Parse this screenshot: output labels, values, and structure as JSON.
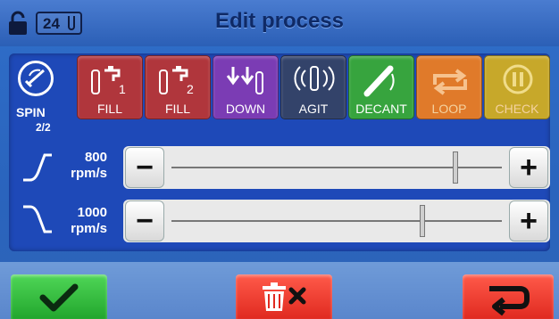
{
  "header": {
    "title": "Edit process",
    "counter": "24",
    "lock_icon": "lock-open-icon"
  },
  "spin": {
    "label": "SPIN",
    "count": "2/2",
    "icon": "spin-icon"
  },
  "steps": [
    {
      "label": "FILL",
      "sub": "1",
      "icon": "fill-tap-icon",
      "color": "#b0363c"
    },
    {
      "label": "FILL",
      "sub": "2",
      "icon": "fill-tap-icon",
      "color": "#b0363c"
    },
    {
      "label": "DOWN",
      "icon": "down-arrows-icon",
      "color": "#7b3cb4"
    },
    {
      "label": "AGIT",
      "icon": "agitate-icon",
      "color": "#33436a"
    },
    {
      "label": "DECANT",
      "icon": "decant-icon",
      "color": "#37a43e"
    },
    {
      "label": "LOOP",
      "icon": "loop-icon",
      "color": "#e07a2a"
    },
    {
      "label": "CHECK",
      "icon": "pause-check-icon",
      "color": "#c7a82a"
    }
  ],
  "accel": {
    "value": "800",
    "unit": "rpm/s",
    "icon": "ramp-up-icon",
    "level_fraction": 0.86
  },
  "decel": {
    "value": "1000",
    "unit": "rpm/s",
    "icon": "ramp-down-icon",
    "level_fraction": 0.76
  },
  "buttons": {
    "minus": "−",
    "plus": "+"
  },
  "footer": {
    "confirm_icon": "checkmark-icon",
    "delete_icon": "trash-x-icon",
    "back_icon": "return-arrow-icon"
  }
}
